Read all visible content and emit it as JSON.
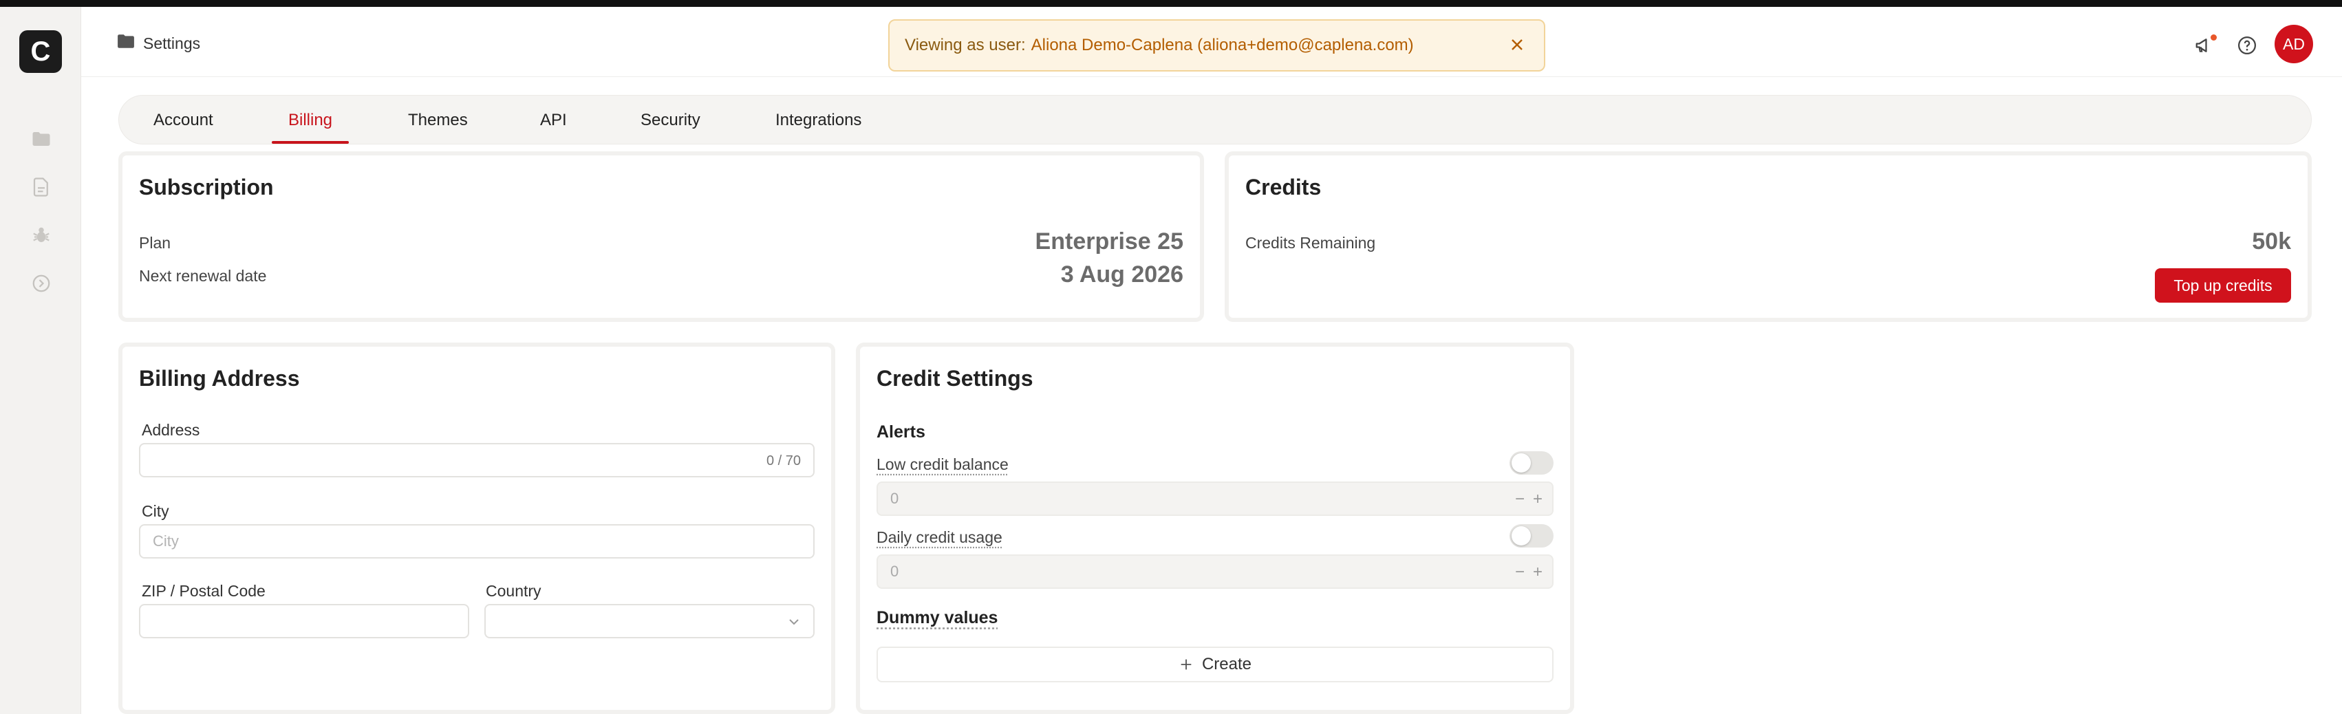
{
  "header": {
    "breadcrumb": "Settings",
    "banner_prefix": "Viewing as user:",
    "banner_user": "Aliona Demo-Caplena (aliona+demo@caplena.com)",
    "avatar_initials": "AD"
  },
  "logo_letter": "C",
  "tabs": [
    {
      "label": "Account"
    },
    {
      "label": "Billing"
    },
    {
      "label": "Themes"
    },
    {
      "label": "API"
    },
    {
      "label": "Security"
    },
    {
      "label": "Integrations"
    }
  ],
  "active_tab": "Billing",
  "subscription": {
    "title": "Subscription",
    "plan_label": "Plan",
    "plan_value": "Enterprise 25",
    "renewal_label": "Next renewal date",
    "renewal_value": "3 Aug 2026"
  },
  "credits": {
    "title": "Credits",
    "remaining_label": "Credits Remaining",
    "remaining_value": "50k",
    "topup_label": "Top up credits"
  },
  "billing_address": {
    "title": "Billing Address",
    "address_label": "Address",
    "address_value": "",
    "address_counter": "0 / 70",
    "city_label": "City",
    "city_placeholder": "City",
    "zip_label": "ZIP / Postal Code",
    "country_label": "Country",
    "country_value": ""
  },
  "credit_settings": {
    "title": "Credit Settings",
    "alerts_label": "Alerts",
    "low_balance_label": "Low credit balance",
    "low_balance_enabled": false,
    "low_balance_value": "0",
    "daily_usage_label": "Daily credit usage",
    "daily_usage_enabled": false,
    "daily_usage_value": "0",
    "dummy_label": "Dummy values",
    "create_label": "Create"
  },
  "stepper": {
    "minus": "−",
    "plus": "+"
  },
  "colors": {
    "accent": "#d0121c",
    "banner_bg": "#fdf4e3",
    "banner_border": "#f2d49a"
  },
  "icons": {
    "sidebar": [
      "folder-icon",
      "document-icon",
      "bug-icon",
      "chevron-right-circle-icon"
    ],
    "header": [
      "megaphone-icon",
      "help-icon"
    ]
  }
}
